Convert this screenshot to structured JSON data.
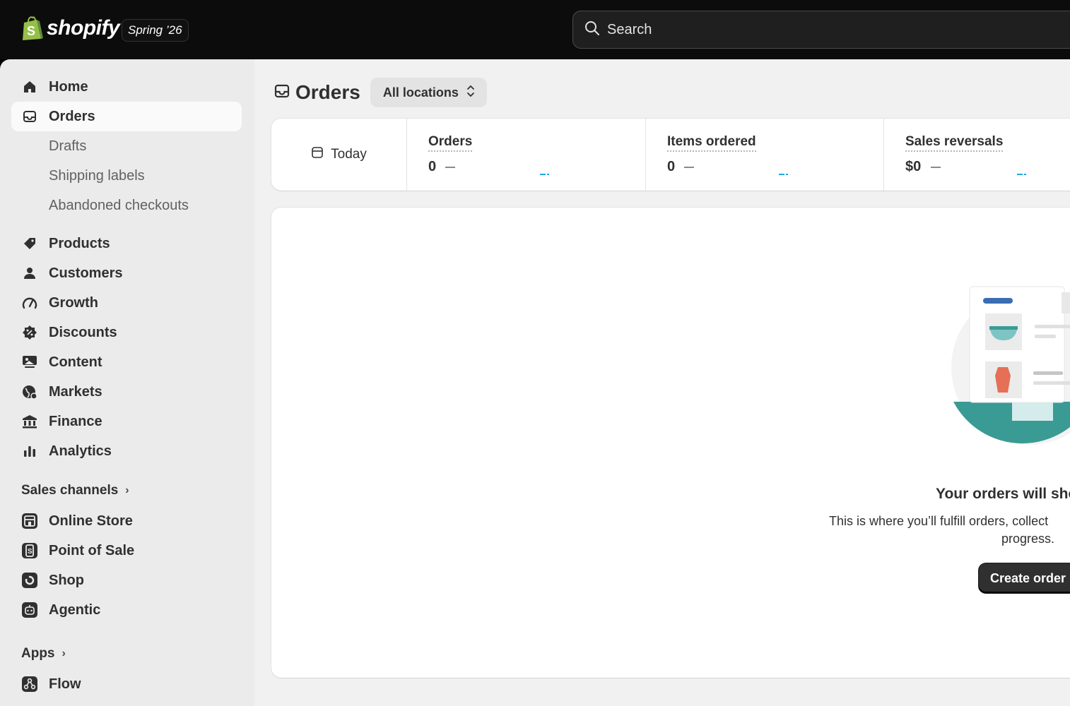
{
  "topbar": {
    "brand": "shopify",
    "edition": "Spring ’26",
    "search_placeholder": "Search"
  },
  "sidebar": {
    "items": [
      {
        "label": "Home",
        "icon": "home-icon"
      },
      {
        "label": "Orders",
        "icon": "inbox-icon",
        "active": true
      },
      {
        "label": "Products",
        "icon": "tag-icon"
      },
      {
        "label": "Customers",
        "icon": "person-icon"
      },
      {
        "label": "Growth",
        "icon": "gauge-icon"
      },
      {
        "label": "Discounts",
        "icon": "discount-icon"
      },
      {
        "label": "Content",
        "icon": "image-icon"
      },
      {
        "label": "Markets",
        "icon": "globe-icon"
      },
      {
        "label": "Finance",
        "icon": "bank-icon"
      },
      {
        "label": "Analytics",
        "icon": "bar-chart-icon"
      }
    ],
    "order_subitems": [
      "Drafts",
      "Shipping labels",
      "Abandoned checkouts"
    ],
    "sales_channels_label": "Sales channels",
    "sales_channels": [
      {
        "label": "Online Store",
        "icon": "store-icon"
      },
      {
        "label": "Point of Sale",
        "icon": "pos-icon"
      },
      {
        "label": "Shop",
        "icon": "shop-icon"
      },
      {
        "label": "Agentic",
        "icon": "agentic-icon"
      }
    ],
    "apps_label": "Apps",
    "apps": [
      {
        "label": "Flow",
        "icon": "flow-icon"
      }
    ]
  },
  "main": {
    "title": "Orders",
    "location_selector": "All locations",
    "date_range": "Today",
    "stats": [
      {
        "label": "Orders",
        "value": "0"
      },
      {
        "label": "Items ordered",
        "value": "0"
      },
      {
        "label": "Sales reversals",
        "value": "$0"
      }
    ],
    "empty_state": {
      "heading": "Your orders will sho",
      "text": "This is where you’ll fulfill orders, collect",
      "text2": "progress.",
      "button": "Create order"
    }
  }
}
